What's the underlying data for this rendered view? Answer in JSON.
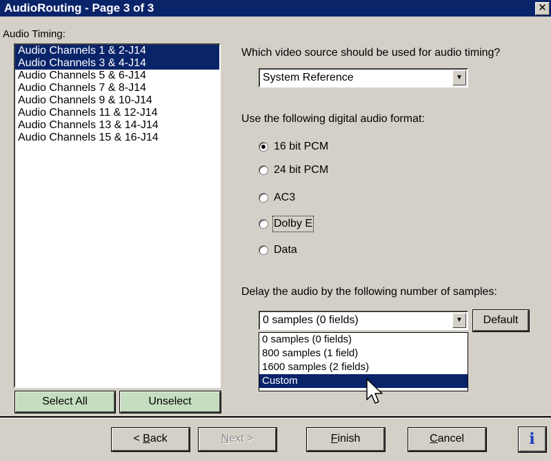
{
  "window": {
    "title": "AudioRouting - Page 3 of 3",
    "close_glyph": "✕"
  },
  "audio_timing": {
    "label": "Audio Timing:",
    "channels": [
      {
        "label": "Audio Channels 1 & 2-J14",
        "selected": true
      },
      {
        "label": "Audio Channels 3 & 4-J14",
        "selected": true
      },
      {
        "label": "Audio Channels 5 & 6-J14",
        "selected": false
      },
      {
        "label": "Audio Channels 7 & 8-J14",
        "selected": false
      },
      {
        "label": "Audio Channels 9 & 10-J14",
        "selected": false
      },
      {
        "label": "Audio Channels 11 & 12-J14",
        "selected": false
      },
      {
        "label": "Audio Channels 13 & 14-J14",
        "selected": false
      },
      {
        "label": "Audio Channels 15 & 16-J14",
        "selected": false
      }
    ],
    "select_all_label": "Select All",
    "unselect_label": "Unselect"
  },
  "video_source": {
    "question": "Which video source should be used for audio timing?",
    "selected": "System Reference"
  },
  "audio_format": {
    "label": "Use the following digital audio format:",
    "options": [
      "16 bit PCM",
      "24 bit PCM",
      "AC3",
      "Dolby E",
      "Data"
    ],
    "selected_index": 0,
    "focused_index": 3
  },
  "delay": {
    "label": "Delay the audio by the following number of samples:",
    "selected": "0 samples (0 fields)",
    "default_label": "Default",
    "dropdown_options": [
      "0 samples (0 fields)",
      "800 samples (1 field)",
      "1600 samples (2  fields)",
      "Custom"
    ],
    "highlighted_index": 3
  },
  "footer": {
    "back": {
      "prefix": "< ",
      "mnemonic": "B",
      "rest": "ack"
    },
    "next": {
      "mnemonic": "N",
      "rest": "ext >"
    },
    "finish": {
      "mnemonic": "F",
      "rest": "inish"
    },
    "cancel": {
      "mnemonic": "C",
      "rest": "ancel"
    },
    "info_glyph": "i"
  },
  "colors": {
    "selection": "#0a246a",
    "dialog_face": "#d4d0c8",
    "green_button": "#c6dec0",
    "info_blue": "#1a3cc6"
  }
}
